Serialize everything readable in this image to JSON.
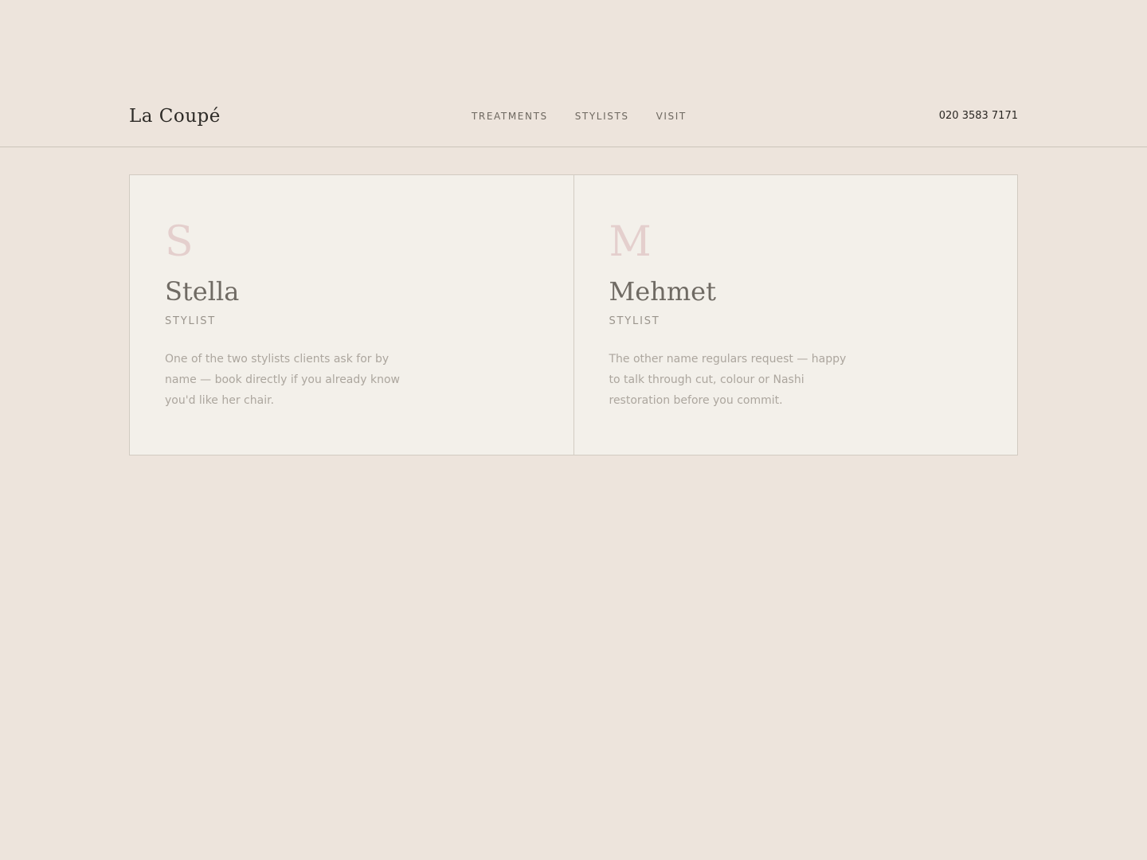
{
  "header": {
    "logo": "La Coupé",
    "nav": [
      "TREATMENTS",
      "STYLISTS",
      "VISIT"
    ],
    "phone": "020 3583 7171"
  },
  "stylists": [
    {
      "initial": "S",
      "name": "Stella",
      "role": "STYLIST",
      "bio": "One of the two stylists clients ask for by name — book directly if you already know you'd like her chair."
    },
    {
      "initial": "M",
      "name": "Mehmet",
      "role": "STYLIST",
      "bio": "The other name regulars request — happy to talk through cut, colour or Nashi restoration before you commit."
    }
  ]
}
